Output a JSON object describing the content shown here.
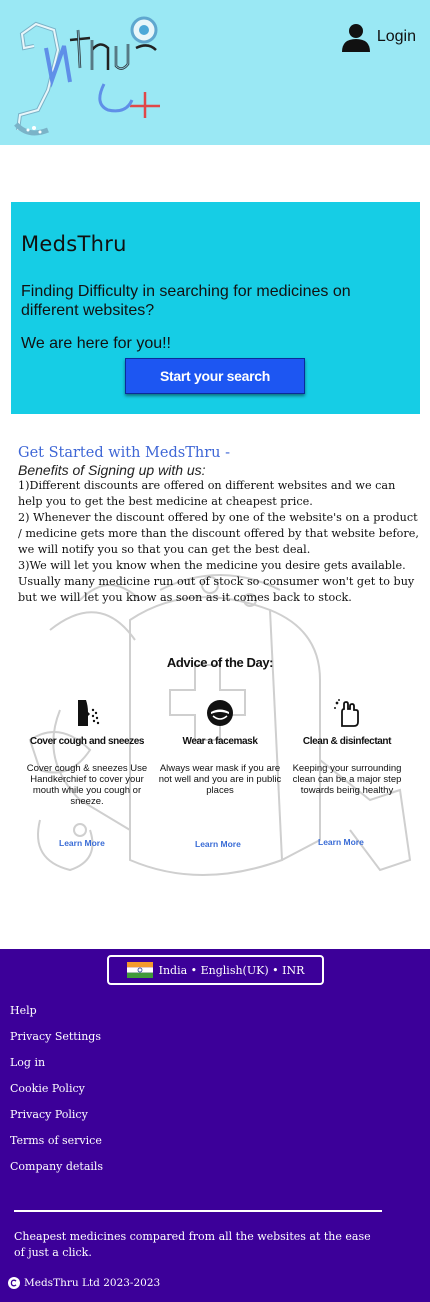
{
  "header": {
    "login_label": "Login",
    "logo_icon": "medsthru-logo",
    "user_icon": "user-icon"
  },
  "hero": {
    "title": "MedsThru",
    "subtitle": "Finding Difficulty in searching for medicines on different websites?",
    "tagline": "We are here for you!!",
    "cta_label": "Start your search",
    "cta_color": "#1d56f2",
    "background_color": "#16cde5"
  },
  "benefits": {
    "title": "Get Started with MedsThru -",
    "subtitle": "Benefits of Signing up with us:",
    "items": [
      "1)Different discounts are offered on different websites and we can help you to get the best medicine at cheapest price.",
      "2) Whenever the discount offered by one of the website's on a product / medicine gets more than the discount offered by that website before, we will notify you so that you can get the best deal.",
      "3)We will let you know when the medicine you desire gets available. Usually many medicine run out of stock so consumer won't get to buy but we will let you know as soon as it comes back to stock."
    ]
  },
  "advice": {
    "title": "Advice of the Day:",
    "items": [
      {
        "icon": "cough-icon",
        "heading": "Cover cough and sneezes",
        "text": "Cover cough & sneezes Use Handkerchief to cover your mouth while you cough or sneeze.",
        "link": "Learn More"
      },
      {
        "icon": "facemask-icon",
        "heading": "Wear a facemask",
        "text": "Always wear mask if you are not well and you are in public places",
        "link": "Learn More"
      },
      {
        "icon": "clean-hand-icon",
        "heading": "Clean & disinfectant",
        "text": "Keeping your surrounding clean can be a major step towards being healthy",
        "link": "Learn More"
      }
    ]
  },
  "footer": {
    "locale_label": "India • English(UK) • INR",
    "links": [
      "Help",
      "Privacy Settings",
      "Log in",
      "Cookie Policy",
      "Privacy Policy",
      "Terms of service",
      "Company details"
    ],
    "tagline": "Cheapest medicines compared from all the websites at the ease of just a click.",
    "copyright": "MedsThru Ltd 2023-2023",
    "background_color": "#3c0099"
  }
}
